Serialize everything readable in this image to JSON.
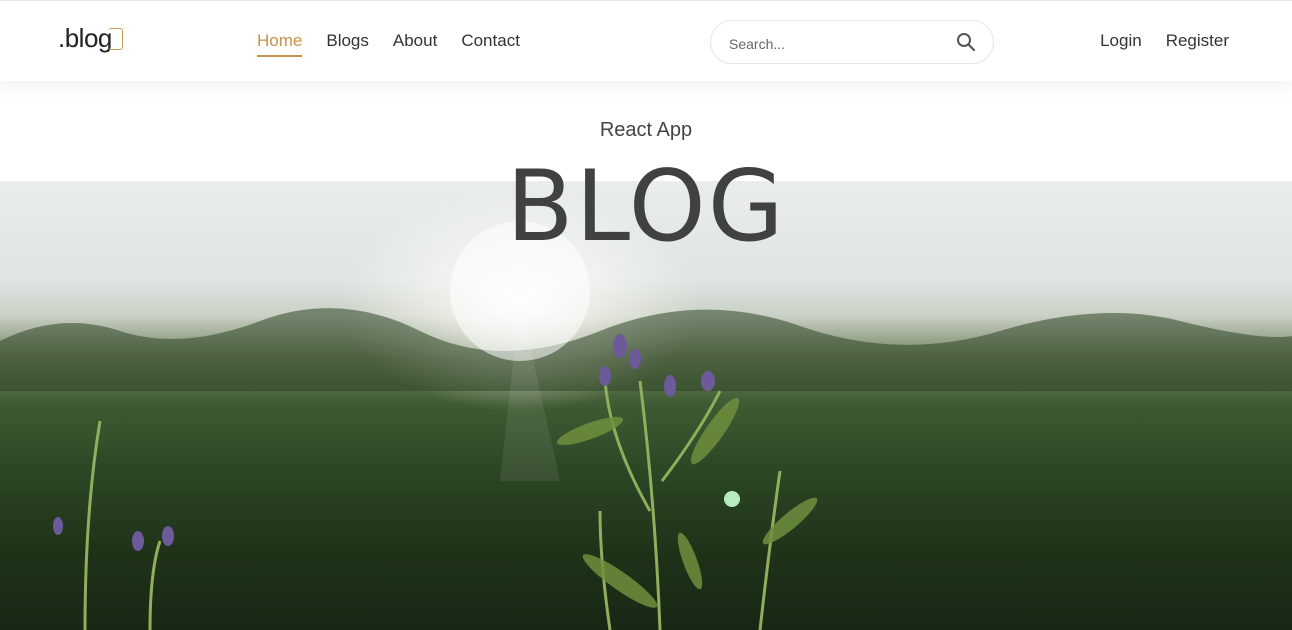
{
  "logo": {
    "text": ".blog"
  },
  "nav": {
    "items": [
      {
        "label": "Home",
        "active": true
      },
      {
        "label": "Blogs",
        "active": false
      },
      {
        "label": "About",
        "active": false
      },
      {
        "label": "Contact",
        "active": false
      }
    ]
  },
  "search": {
    "placeholder": "Search...",
    "icon": "search-icon"
  },
  "auth": {
    "login_label": "Login",
    "register_label": "Register"
  },
  "hero": {
    "subtitle": "React App",
    "title": "BLOG",
    "image": "meadow-flowers-sunset-photo"
  },
  "colors": {
    "accent": "#c7924a",
    "text": "#333333",
    "title": "#414141"
  }
}
